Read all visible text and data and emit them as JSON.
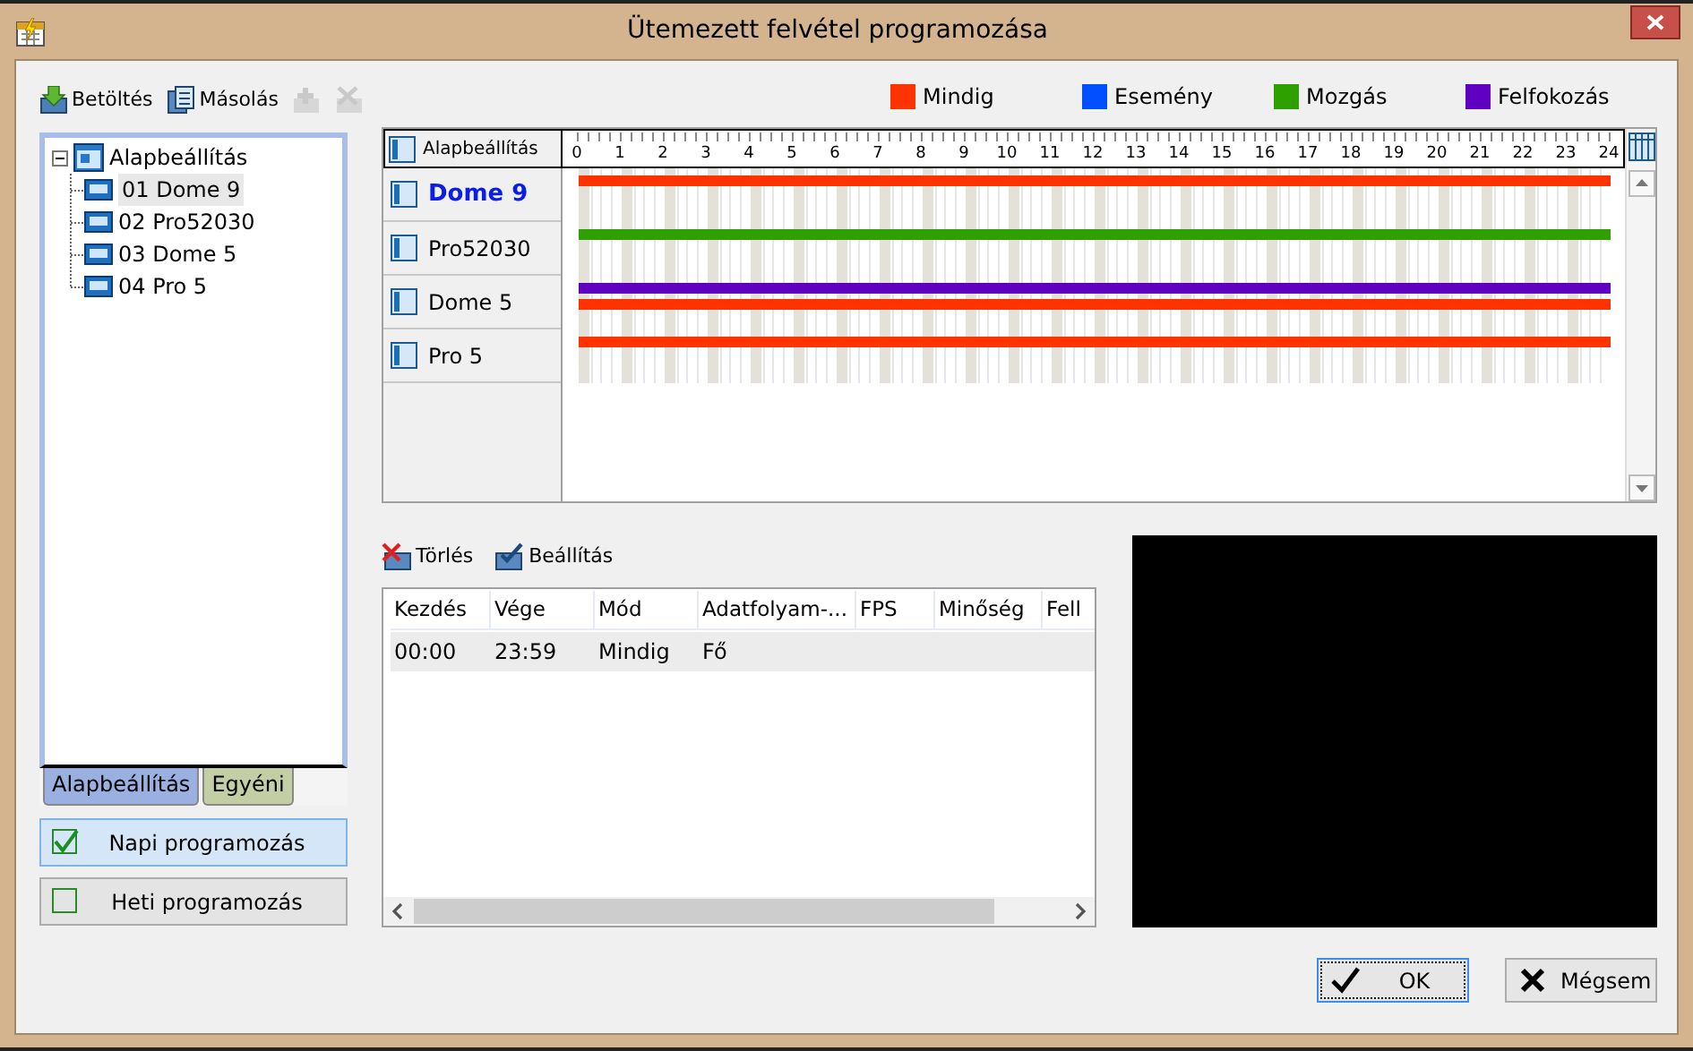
{
  "window": {
    "title": "Ütemezett felvétel programozása"
  },
  "tree_toolbar": [
    {
      "label": "Betöltés",
      "disabled": false,
      "kind": "load"
    },
    {
      "label": "Másolás",
      "disabled": false,
      "kind": "copy"
    },
    {
      "disabled": true,
      "kind": "add"
    },
    {
      "disabled": true,
      "kind": "remove"
    }
  ],
  "tree": {
    "label": "Alapbeállítás",
    "expanded": true,
    "children": [
      {
        "label": "01 Dome 9",
        "selected": true
      },
      {
        "label": "02 Pro52030",
        "selected": false
      },
      {
        "label": "03 Dome 5",
        "selected": false
      },
      {
        "label": "04 Pro 5",
        "selected": false
      }
    ]
  },
  "tree_tabs": [
    {
      "label": "Alapbeállítás",
      "selected": true
    },
    {
      "label": "Egyéni",
      "selected": false
    }
  ],
  "mode_buttons": [
    {
      "label": "Napi programozás",
      "checked": true
    },
    {
      "label": "Heti programozás",
      "checked": false
    }
  ],
  "legend": [
    {
      "label": "Mindig",
      "color": "#ff3300"
    },
    {
      "label": "Esemény",
      "color": "#0050ff"
    },
    {
      "label": "Mozgás",
      "color": "#2ea000"
    },
    {
      "label": "Felfokozás",
      "color": "#6000c0"
    }
  ],
  "schedule": {
    "header": "Alapbeállítás",
    "hours": [
      "0",
      "1",
      "2",
      "3",
      "4",
      "5",
      "6",
      "7",
      "8",
      "9",
      "10",
      "11",
      "12",
      "13",
      "14",
      "15",
      "16",
      "17",
      "18",
      "19",
      "20",
      "21",
      "22",
      "23",
      "24"
    ],
    "rows": [
      {
        "label": "Dome 9",
        "selected": true,
        "bars": [
          {
            "color": "#ff3300"
          }
        ]
      },
      {
        "label": "Pro52030",
        "selected": false,
        "bars": [
          {
            "color": "#2ea000"
          }
        ]
      },
      {
        "label": "Dome 5",
        "selected": false,
        "bars": [
          {
            "color": "#6000c0"
          },
          {
            "color": "#ff3300"
          }
        ]
      },
      {
        "label": "Pro 5",
        "selected": false,
        "bars": [
          {
            "color": "#ff3300"
          }
        ]
      }
    ]
  },
  "table_toolbar": [
    {
      "label": "Törlés",
      "kind": "delete"
    },
    {
      "label": "Beállítás",
      "kind": "settings"
    }
  ],
  "table": {
    "columns": [
      "Kezdés",
      "Vége",
      "Mód",
      "Adatfolyam-...",
      "FPS",
      "Minőség",
      "Fell"
    ],
    "rows": [
      {
        "cells": [
          "00:00",
          "23:59",
          "Mindig",
          "Fő",
          "",
          "",
          ""
        ],
        "selected": true
      }
    ]
  },
  "buttons": [
    {
      "label": "OK",
      "kind": "ok"
    },
    {
      "label": "Mégsem",
      "kind": "cancel"
    }
  ]
}
